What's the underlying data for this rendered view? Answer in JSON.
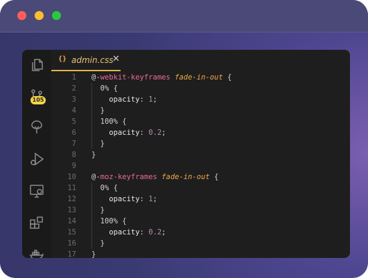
{
  "window": {
    "traffic_lights": [
      "close",
      "minimize",
      "zoom"
    ]
  },
  "activity_bar": {
    "icons": [
      "files-icon",
      "source-control-icon",
      "tree-icon",
      "run-debug-icon",
      "remote-monitor-icon",
      "extensions-icon",
      "docker-icon"
    ],
    "source_control_badge": "105"
  },
  "tab": {
    "icon": "{}",
    "label": "admin.css",
    "close": "✕"
  },
  "code": {
    "lines": [
      {
        "n": "1",
        "parts": [
          [
            "at",
            "@-"
          ],
          [
            "kw",
            "webkit-keyframes"
          ],
          [
            "punc",
            " "
          ],
          [
            "name",
            "fade-in-out"
          ],
          [
            "punc",
            " {"
          ]
        ]
      },
      {
        "n": "2",
        "parts": [
          [
            "punc",
            "  0% {"
          ]
        ]
      },
      {
        "n": "3",
        "parts": [
          [
            "prop",
            "    opacity"
          ],
          [
            "punc",
            ": "
          ],
          [
            "num",
            "1"
          ],
          [
            "punc",
            ";"
          ]
        ]
      },
      {
        "n": "4",
        "parts": [
          [
            "punc",
            "  }"
          ]
        ]
      },
      {
        "n": "5",
        "parts": [
          [
            "punc",
            "  100% {"
          ]
        ]
      },
      {
        "n": "6",
        "parts": [
          [
            "prop",
            "    opacity"
          ],
          [
            "punc",
            ": "
          ],
          [
            "num",
            "0.2"
          ],
          [
            "punc",
            ";"
          ]
        ]
      },
      {
        "n": "7",
        "parts": [
          [
            "punc",
            "  }"
          ]
        ]
      },
      {
        "n": "8",
        "parts": [
          [
            "punc",
            "}"
          ]
        ]
      },
      {
        "n": "9",
        "parts": []
      },
      {
        "n": "10",
        "parts": [
          [
            "at",
            "@-"
          ],
          [
            "kw",
            "moz-keyframes"
          ],
          [
            "punc",
            " "
          ],
          [
            "name",
            "fade-in-out"
          ],
          [
            "punc",
            " {"
          ]
        ]
      },
      {
        "n": "11",
        "parts": [
          [
            "punc",
            "  0% {"
          ]
        ]
      },
      {
        "n": "12",
        "parts": [
          [
            "prop",
            "    opacity"
          ],
          [
            "punc",
            ": "
          ],
          [
            "num",
            "1"
          ],
          [
            "punc",
            ";"
          ]
        ]
      },
      {
        "n": "13",
        "parts": [
          [
            "punc",
            "  }"
          ]
        ]
      },
      {
        "n": "14",
        "parts": [
          [
            "punc",
            "  100% {"
          ]
        ]
      },
      {
        "n": "15",
        "parts": [
          [
            "prop",
            "    opacity"
          ],
          [
            "punc",
            ": "
          ],
          [
            "num",
            "0.2"
          ],
          [
            "punc",
            ";"
          ]
        ]
      },
      {
        "n": "16",
        "parts": [
          [
            "punc",
            "  }"
          ]
        ]
      },
      {
        "n": "17",
        "parts": [
          [
            "punc",
            "}"
          ]
        ]
      }
    ]
  },
  "colors": {
    "accent": "#e6b450",
    "keyword": "#e86a9a",
    "name": "#f0a94a",
    "number": "#b48ead",
    "badge": "#f5d547"
  }
}
